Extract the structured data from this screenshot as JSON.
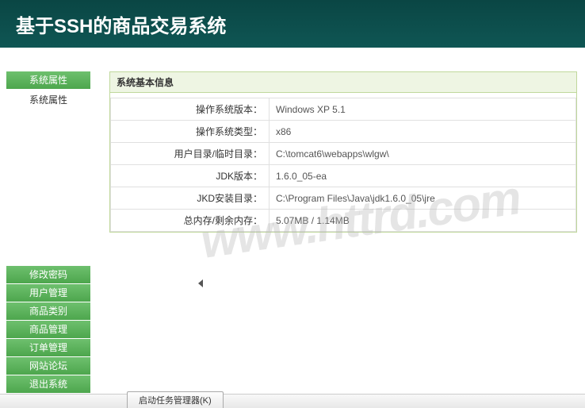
{
  "header": {
    "title": "基于SSH的商品交易系统"
  },
  "sidebar": {
    "top": {
      "active": "系统属性",
      "sub": "系统属性"
    },
    "bottom": [
      "修改密码",
      "用户管理",
      "商品类别",
      "商品管理",
      "订单管理",
      "网站论坛",
      "退出系统"
    ]
  },
  "panel": {
    "title": "系统基本信息",
    "rows": [
      {
        "label": "操作系统版本：",
        "value": "Windows XP  5.1"
      },
      {
        "label": "操作系统类型：",
        "value": "x86"
      },
      {
        "label": "用户目录/临时目录：",
        "value": "C:\\tomcat6\\webapps\\wlgw\\"
      },
      {
        "label": "JDK版本：",
        "value": "1.6.0_05-ea"
      },
      {
        "label": "JKD安装目录：",
        "value": "C:\\Program Files\\Java\\jdk1.6.0_05\\jre"
      },
      {
        "label": "总内存/剩余内存：",
        "value": "5.07MB / 1.14MB"
      }
    ]
  },
  "taskbar": {
    "button": "启动任务管理器(K)"
  },
  "watermark": "www.httrd.com"
}
